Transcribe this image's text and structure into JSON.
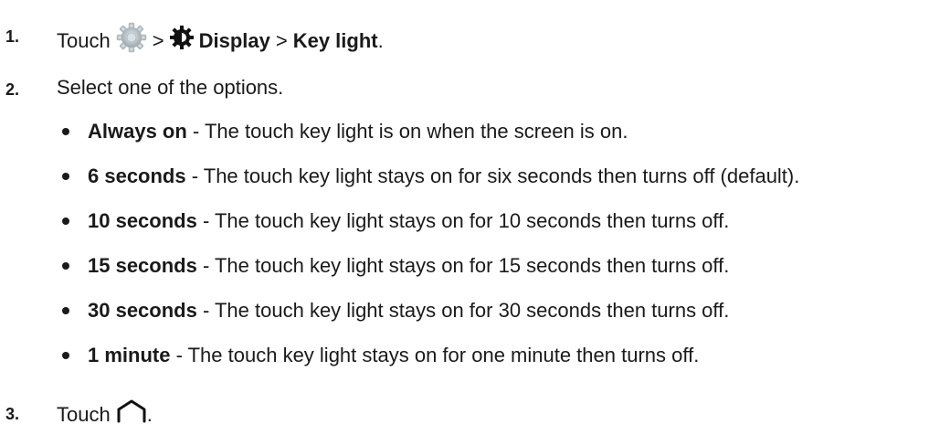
{
  "steps": [
    {
      "number": "1.",
      "touch": "Touch",
      "sep1": ">",
      "display": "Display",
      "sep2": ">",
      "key_light": "Key light",
      "period": ".",
      "icons": [
        "settings-gear-icon",
        "display-brightness-icon"
      ]
    },
    {
      "number": "2.",
      "text": "Select one of the options."
    },
    {
      "number": "3.",
      "touch": "Touch",
      "period": ".",
      "icons": [
        "home-icon"
      ]
    }
  ],
  "options": [
    {
      "label": "Always on",
      "desc": " - The touch key light is on when the screen is on."
    },
    {
      "label": "6 seconds",
      "desc": " - The touch key light stays on for six seconds then turns off (default)."
    },
    {
      "label": "10 seconds",
      "desc": " - The touch key light stays on for 10 seconds then turns off."
    },
    {
      "label": "15 seconds",
      "desc": " - The touch key light stays on for 15 seconds then turns off."
    },
    {
      "label": "30 seconds",
      "desc": " - The touch key light stays on for 30 seconds then turns off."
    },
    {
      "label": "1 minute",
      "desc": " - The touch key light stays on for one minute then turns off."
    }
  ]
}
